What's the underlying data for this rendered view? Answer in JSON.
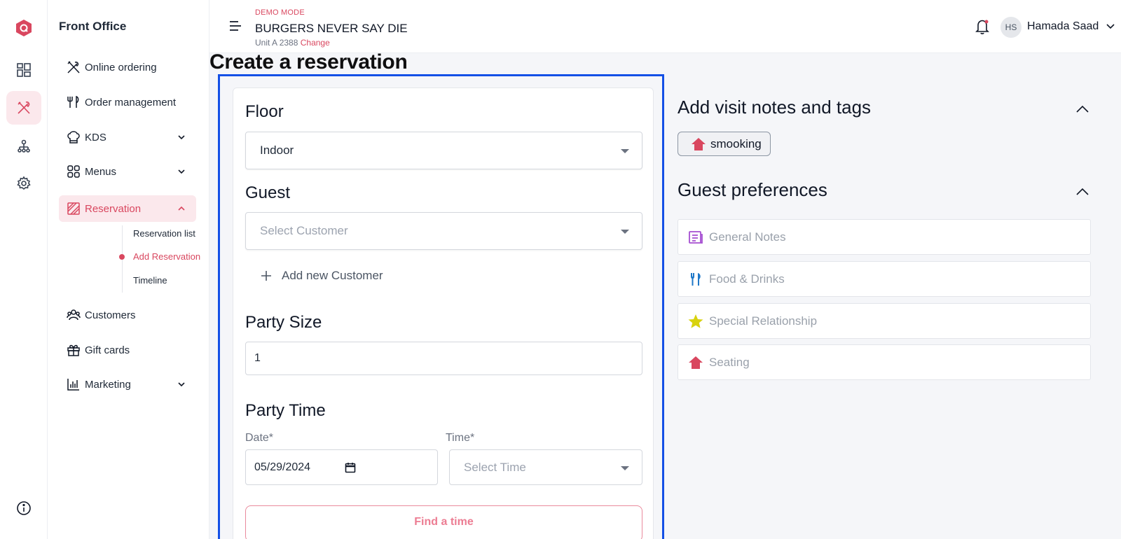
{
  "rail": {
    "icons": [
      "logo-icon",
      "dashboard-icon",
      "utensils-icon",
      "org-chart-icon",
      "settings-icon",
      "info-icon"
    ]
  },
  "sidebar": {
    "title": "Front Office",
    "items": [
      {
        "label": "Online ordering",
        "icon": "utensils-cross-icon"
      },
      {
        "label": "Order management",
        "icon": "fork-knife-icon"
      },
      {
        "label": "KDS",
        "icon": "chef-hat-icon"
      },
      {
        "label": "Menus",
        "icon": "grid-icon"
      },
      {
        "label": "Reservation",
        "icon": "reservation-icon"
      },
      {
        "label": "Customers",
        "icon": "users-icon"
      },
      {
        "label": "Gift cards",
        "icon": "gift-icon"
      },
      {
        "label": "Marketing",
        "icon": "bar-chart-icon"
      }
    ],
    "sub_items": [
      {
        "label": "Reservation list"
      },
      {
        "label": "Add Reservation"
      },
      {
        "label": "Timeline"
      }
    ]
  },
  "header": {
    "mode": "DEMO MODE",
    "store_name": "BURGERS NEVER SAY DIE",
    "unit": "Unit A 2388",
    "change_label": "Change",
    "user_initials": "HS",
    "user_name": "Hamada Saad"
  },
  "page": {
    "title": "Create a reservation"
  },
  "form": {
    "floor_heading": "Floor",
    "floor_value": "Indoor",
    "guest_heading": "Guest",
    "guest_placeholder": "Select Customer",
    "add_customer_label": "Add new Customer",
    "party_size_heading": "Party Size",
    "party_size_value": "1",
    "party_time_heading": "Party Time",
    "date_label": "Date*",
    "date_value": "05/29/2024",
    "time_label": "Time*",
    "time_placeholder": "Select Time",
    "find_button": "Find a time"
  },
  "visit_notes": {
    "heading": "Add visit notes and tags",
    "tags": [
      {
        "label": "smooking",
        "icon": "house-icon"
      }
    ]
  },
  "guest_preferences": {
    "heading": "Guest preferences",
    "items": [
      {
        "label": "General Notes",
        "icon": "notes-icon",
        "color": "#a64fd1"
      },
      {
        "label": "Food & Drinks",
        "icon": "fork-knife-icon",
        "color": "#1f78c8"
      },
      {
        "label": "Special Relationship",
        "icon": "star-icon",
        "color": "#d8d20f"
      },
      {
        "label": "Seating",
        "icon": "house-icon",
        "color": "#d9475f"
      }
    ]
  },
  "colors": {
    "accent": "#d9475f",
    "accent_light": "#fbe8ec",
    "highlight_frame": "#1450e6"
  }
}
